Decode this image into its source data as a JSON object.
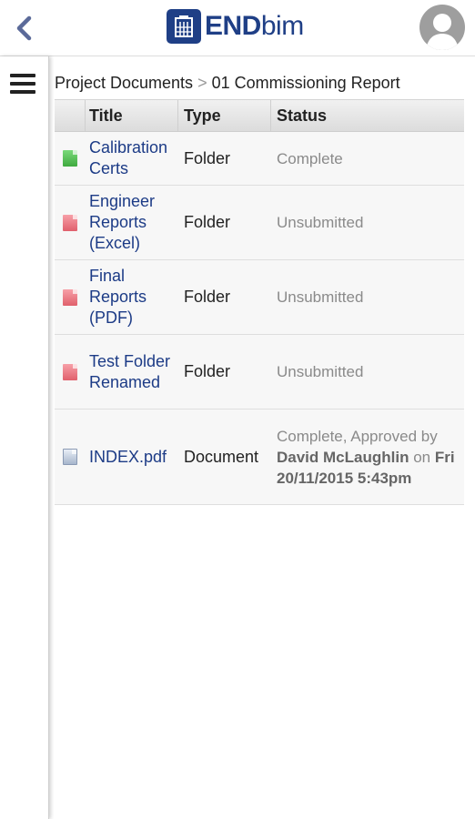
{
  "header": {
    "back_icon": "chevron-left-icon",
    "logo_text_bold": "END",
    "logo_text_thin": "bim",
    "avatar_icon": "user-silhouette-icon",
    "brand_color": "#1f3f86"
  },
  "sidebar": {
    "menu_icon": "hamburger-menu-icon"
  },
  "breadcrumb": {
    "root": "Project Documents",
    "separator": ">",
    "current": "01 Commissioning Report"
  },
  "table": {
    "headers": {
      "title": "Title",
      "type": "Type",
      "status": "Status"
    },
    "rows": [
      {
        "icon": "green-file-icon",
        "title": "Calibration Certs",
        "type": "Folder",
        "status": "Complete"
      },
      {
        "icon": "red-file-icon",
        "title": "Engineer Reports (Excel)",
        "type": "Folder",
        "status": "Unsubmitted"
      },
      {
        "icon": "red-file-icon",
        "title": "Final Reports (PDF)",
        "type": "Folder",
        "status": "Unsubmitted"
      },
      {
        "icon": "red-file-icon",
        "title": "Test Folder Renamed",
        "type": "Folder",
        "status": "Unsubmitted"
      },
      {
        "icon": "document-icon",
        "title": "INDEX.pdf",
        "type": "Document",
        "status_prefix": "Complete, Approved by",
        "approver": "David McLaughlin",
        "status_on": "on",
        "approved_date": "Fri 20/11/2015 5:43pm"
      }
    ]
  }
}
